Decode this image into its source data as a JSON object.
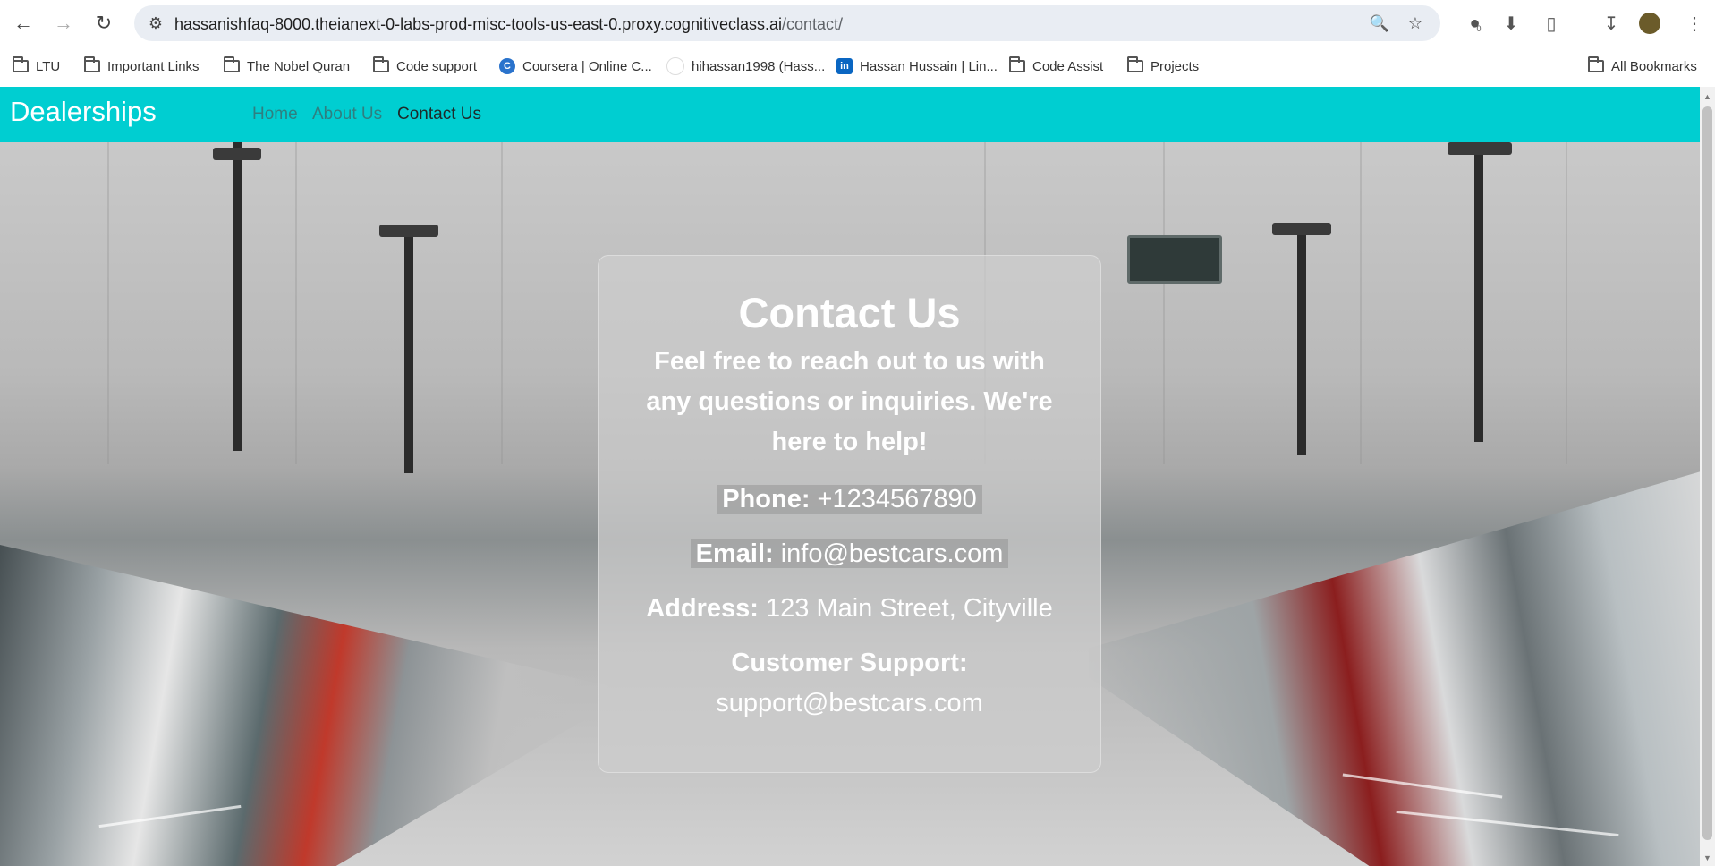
{
  "browser": {
    "url_host": "hassanishfaq-8000.theianext-0-labs-prod-misc-tools-us-east-0.proxy.cognitiveclass.ai",
    "url_path": "/contact/",
    "extension_badge": "0",
    "bookmarks": [
      {
        "label": "LTU",
        "icon": "folder-icon"
      },
      {
        "label": "Important Links",
        "icon": "folder-icon"
      },
      {
        "label": "The Nobel Quran",
        "icon": "folder-icon"
      },
      {
        "label": "Code support",
        "icon": "folder-icon"
      },
      {
        "label": "Coursera | Online C...",
        "icon": "coursera-icon"
      },
      {
        "label": "hihassan1998 (Hass...",
        "icon": "github-icon"
      },
      {
        "label": "Hassan Hussain | Lin...",
        "icon": "linkedin-icon"
      },
      {
        "label": "Code Assist",
        "icon": "folder-icon"
      },
      {
        "label": "Projects",
        "icon": "folder-icon"
      }
    ],
    "all_bookmarks": "All Bookmarks"
  },
  "navbar": {
    "brand": "Dealerships",
    "links": [
      "Home",
      "About Us",
      "Contact Us"
    ],
    "active": "Contact Us",
    "color": "#00ced1"
  },
  "contact": {
    "title": "Contact Us",
    "intro": "Feel free to reach out to us with any questions or inquiries. We're here to help!",
    "phone_label": "Phone:",
    "phone": "+1234567890",
    "email_label": "Email:",
    "email": "info@bestcars.com",
    "address_label": "Address:",
    "address": "123 Main Street, Cityville",
    "support_label": "Customer Support:",
    "support_email": "support@bestcars.com"
  }
}
